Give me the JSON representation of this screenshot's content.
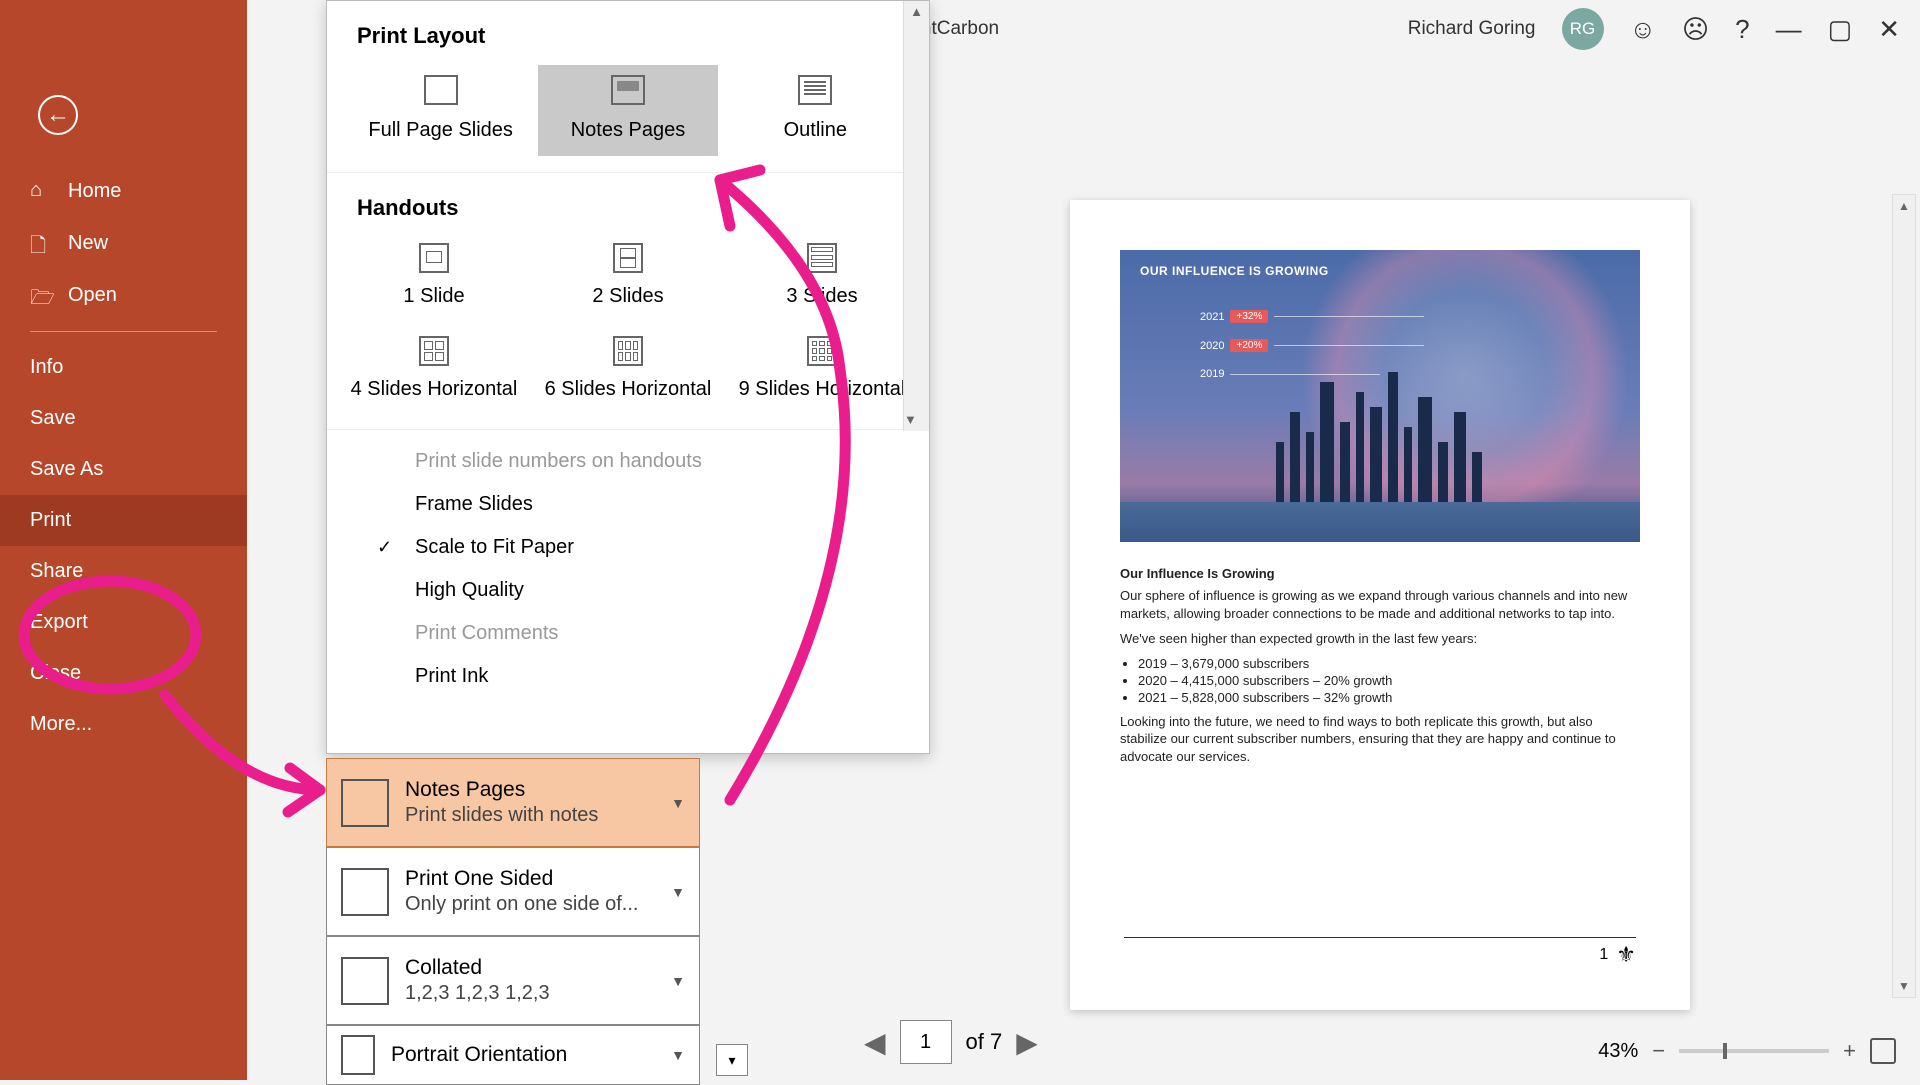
{
  "title_bar": {
    "doc_fragment": "htCarbon",
    "user_name": "Richard Goring",
    "avatar_initials": "RG"
  },
  "sidebar": {
    "items": [
      {
        "label": "Home"
      },
      {
        "label": "New"
      },
      {
        "label": "Open"
      },
      {
        "label": "Info"
      },
      {
        "label": "Save"
      },
      {
        "label": "Save As"
      },
      {
        "label": "Print",
        "selected": true
      },
      {
        "label": "Share"
      },
      {
        "label": "Export"
      },
      {
        "label": "Close"
      },
      {
        "label": "More..."
      }
    ]
  },
  "popup": {
    "section_layout": "Print Layout",
    "layouts": [
      {
        "label": "Full Page Slides"
      },
      {
        "label": "Notes Pages",
        "selected": true
      },
      {
        "label": "Outline"
      }
    ],
    "section_handouts": "Handouts",
    "handouts_row1": [
      {
        "label": "1 Slide"
      },
      {
        "label": "2 Slides"
      },
      {
        "label": "3 Slides"
      }
    ],
    "handouts_row2": [
      {
        "label": "4 Slides Horizontal"
      },
      {
        "label": "6 Slides Horizontal"
      },
      {
        "label": "9 Slides Horizontal"
      }
    ],
    "options": [
      {
        "label": "Print slide numbers on handouts",
        "disabled": true
      },
      {
        "label": "Frame Slides"
      },
      {
        "label": "Scale to Fit Paper",
        "checked": true
      },
      {
        "label": "High Quality"
      },
      {
        "label": "Print Comments",
        "disabled": true
      },
      {
        "label": "Print Ink"
      }
    ]
  },
  "settings": {
    "layout": {
      "line1": "Notes Pages",
      "line2": "Print slides with notes"
    },
    "sides": {
      "line1": "Print One Sided",
      "line2": "Only print on one side of..."
    },
    "collate": {
      "line1": "Collated",
      "line2": "1,2,3    1,2,3    1,2,3"
    },
    "orient": {
      "line1": "Portrait Orientation"
    }
  },
  "preview": {
    "slide_header": "OUR INFLUENCE IS GROWING",
    "rows": [
      {
        "year": "2021",
        "badge": "+32%"
      },
      {
        "year": "2020",
        "badge": "+20%"
      },
      {
        "year": "2019",
        "badge": ""
      }
    ],
    "notes_title": "Our Influence Is Growing",
    "notes_p1": "Our sphere of influence is growing as we expand through various channels and into new markets, allowing broader connections to be made and additional networks to tap into.",
    "notes_p2": "We've seen higher than expected growth in the last few years:",
    "bullets": [
      "2019 – 3,679,000 subscribers",
      "2020 – 4,415,000 subscribers – 20% growth",
      "2021 – 5,828,000 subscribers – 32% growth"
    ],
    "notes_p3": "Looking into the future, we need to find ways to both replicate this growth, but also stabilize our current subscriber numbers, ensuring that they are happy and continue to advocate our services.",
    "page_number": "1"
  },
  "page_nav": {
    "current": "1",
    "total_label": "of 7"
  },
  "zoom": {
    "pct": "43%"
  }
}
